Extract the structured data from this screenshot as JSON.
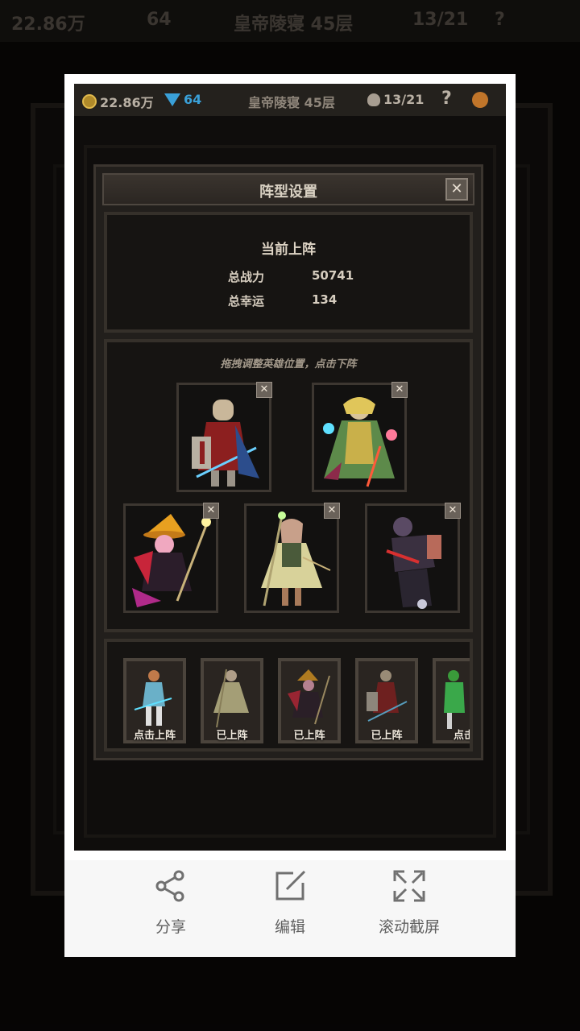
{
  "background": {
    "gold": "22.86万",
    "gems": "64",
    "location": "皇帝陵寝 45层",
    "progress": "13/21",
    "help": "?"
  },
  "screenshot": {
    "top_bar": {
      "gold": "22.86万",
      "gems": "64",
      "location": "皇帝陵寝 45层",
      "progress": "13/21",
      "help": "?"
    },
    "dialog": {
      "title": "阵型设置",
      "close": "✕",
      "stats_title": "当前上阵",
      "power_label": "总战力",
      "power_value": "50741",
      "luck_label": "总幸运",
      "luck_value": "134",
      "hint": "拖拽调整英雄位置，点击下阵",
      "slot_remove": "✕",
      "roster": [
        {
          "label": "点击上阵"
        },
        {
          "label": "已上阵"
        },
        {
          "label": "已上阵"
        },
        {
          "label": "已上阵"
        },
        {
          "label": "点击"
        }
      ]
    }
  },
  "actions": {
    "share": "分享",
    "edit": "编辑",
    "scroll_capture": "滚动截屏"
  },
  "colors": {
    "accent_text": "#d8d0c2",
    "action_icon": "#707070"
  }
}
